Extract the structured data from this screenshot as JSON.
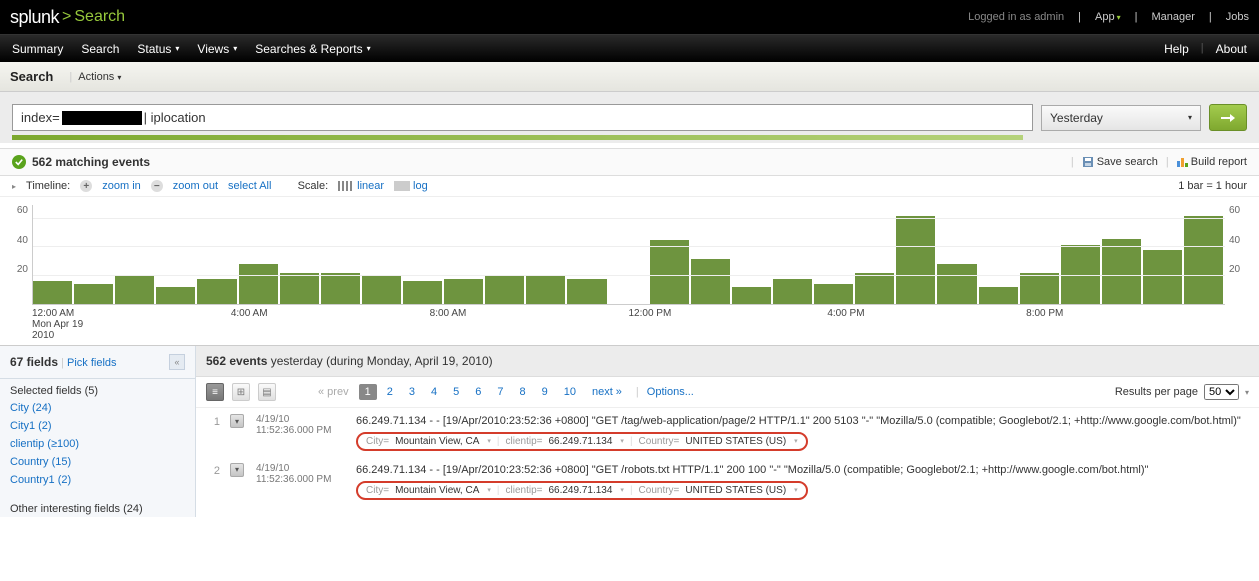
{
  "top": {
    "logged_in": "Logged in as admin",
    "app": "App",
    "manager": "Manager",
    "jobs": "Jobs"
  },
  "brand": {
    "name": "splunk",
    "app": "Search"
  },
  "nav": {
    "items": [
      "Summary",
      "Search",
      "Status",
      "Views",
      "Searches & Reports"
    ],
    "help": "Help",
    "about": "About"
  },
  "sub": {
    "title": "Search",
    "actions": "Actions"
  },
  "search": {
    "prefix": "index=",
    "suffix": " | iplocation",
    "time_range": "Yesterday"
  },
  "status": {
    "count": "562",
    "text": "matching events",
    "save": "Save search",
    "build": "Build report"
  },
  "timeline_ctrl": {
    "label": "Timeline:",
    "zoom_in": "zoom in",
    "zoom_out": "zoom out",
    "select_all": "select All",
    "scale": "Scale:",
    "linear": "linear",
    "log": "log",
    "hint": "1 bar = 1 hour"
  },
  "chart_data": {
    "type": "bar",
    "x_ticks": [
      {
        "label": "12:00 AM",
        "sub1": "Mon Apr 19",
        "sub2": "2010"
      },
      {
        "label": "4:00 AM"
      },
      {
        "label": "8:00 AM"
      },
      {
        "label": "12:00 PM"
      },
      {
        "label": "4:00 PM"
      },
      {
        "label": "8:00 PM"
      }
    ],
    "y_ticks": [
      20,
      40,
      60
    ],
    "ylim": [
      0,
      70
    ],
    "values": [
      16,
      14,
      20,
      12,
      18,
      28,
      22,
      22,
      20,
      16,
      18,
      20,
      20,
      18,
      0,
      45,
      32,
      12,
      18,
      14,
      22,
      62,
      28,
      12,
      22,
      42,
      46,
      38,
      62
    ]
  },
  "fields": {
    "summary": "67 fields",
    "pick": "Pick fields",
    "sel_head": "Selected fields (5)",
    "selected": [
      {
        "n": "City",
        "c": "(24)"
      },
      {
        "n": "City1",
        "c": "(2)"
      },
      {
        "n": "clientip",
        "c": "(≥100)"
      },
      {
        "n": "Country",
        "c": "(15)"
      },
      {
        "n": "Country1",
        "c": "(2)"
      }
    ],
    "other_head": "Other interesting fields (24)"
  },
  "events": {
    "head_count": "562 events",
    "head_rest": " yesterday (during Monday, April 19, 2010)",
    "prev": "« prev",
    "pages": [
      "1",
      "2",
      "3",
      "4",
      "5",
      "6",
      "7",
      "8",
      "9",
      "10"
    ],
    "next": "next »",
    "options": "Options...",
    "rpp_label": "Results per page",
    "rpp_value": "50",
    "rows": [
      {
        "num": "1",
        "date": "4/19/10",
        "time": "11:52:36.000 PM",
        "raw": "66.249.71.134 - - [19/Apr/2010:23:52:36 +0800] \"GET /tag/web-application/page/2 HTTP/1.1\" 200 5103 \"-\" \"Mozilla/5.0 (compatible; Googlebot/2.1; +http://www.google.com/bot.html)\"",
        "tags": {
          "city": "Mountain View, CA",
          "clientip": "66.249.71.134",
          "country": "UNITED STATES (US)"
        }
      },
      {
        "num": "2",
        "date": "4/19/10",
        "time": "11:52:36.000 PM",
        "raw": "66.249.71.134 - - [19/Apr/2010:23:52:36 +0800] \"GET /robots.txt HTTP/1.1\" 200 100 \"-\" \"Mozilla/5.0 (compatible; Googlebot/2.1; +http://www.google.com/bot.html)\"",
        "tags": {
          "city": "Mountain View, CA",
          "clientip": "66.249.71.134",
          "country": "UNITED STATES (US)"
        }
      }
    ]
  }
}
